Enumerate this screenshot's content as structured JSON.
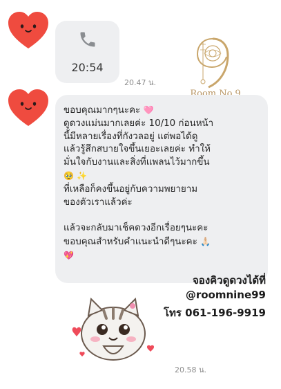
{
  "call": {
    "duration": "20:54",
    "icon": "phone-icon"
  },
  "timestamps": {
    "first": "20.47 น.",
    "second": "20.58 น."
  },
  "logo": {
    "text": "Room No.9",
    "glyph": "9"
  },
  "message": {
    "lines": [
      "ขอบคุณมากๆนะคะ",
      "ดูดวงแม่นมากเลยค่ะ 10/10 ก่อนหน้า",
      "นี้มีหลายเรื่องที่กังวลอยู่ แต่พอได้ดู",
      "แล้วรู้สึกสบายใจขึ้นเยอะเลยค่ะ ทำให้",
      "มั่นใจกับงานและสิ่งที่แพลนไว้มากขึ้น",
      "",
      "ที่เหลือก็คงขึ้นอยู่กับความพยายาม",
      "ของตัวเราแล้วค่ะ",
      "แล้วจะกลับมาเช็คดวงอีกเรื่อยๆนะคะ",
      "ขอบคุณสำหรับคำแนะนำดีๆนะคะ"
    ],
    "emojis": {
      "heart": "🩷",
      "pleading": "🥹",
      "sparkles": "✨",
      "pray": "🙏🏻",
      "sparkle_heart": "💖"
    }
  },
  "promo": {
    "line1": "จองคิวดูดวงได้ที่",
    "line2": "@roomnine99",
    "line3": "โทร 061-196-9919"
  },
  "colors": {
    "heart": "#ef4b3f",
    "bubble": "#eeeff1",
    "logo_gold": "#c9a66b"
  }
}
